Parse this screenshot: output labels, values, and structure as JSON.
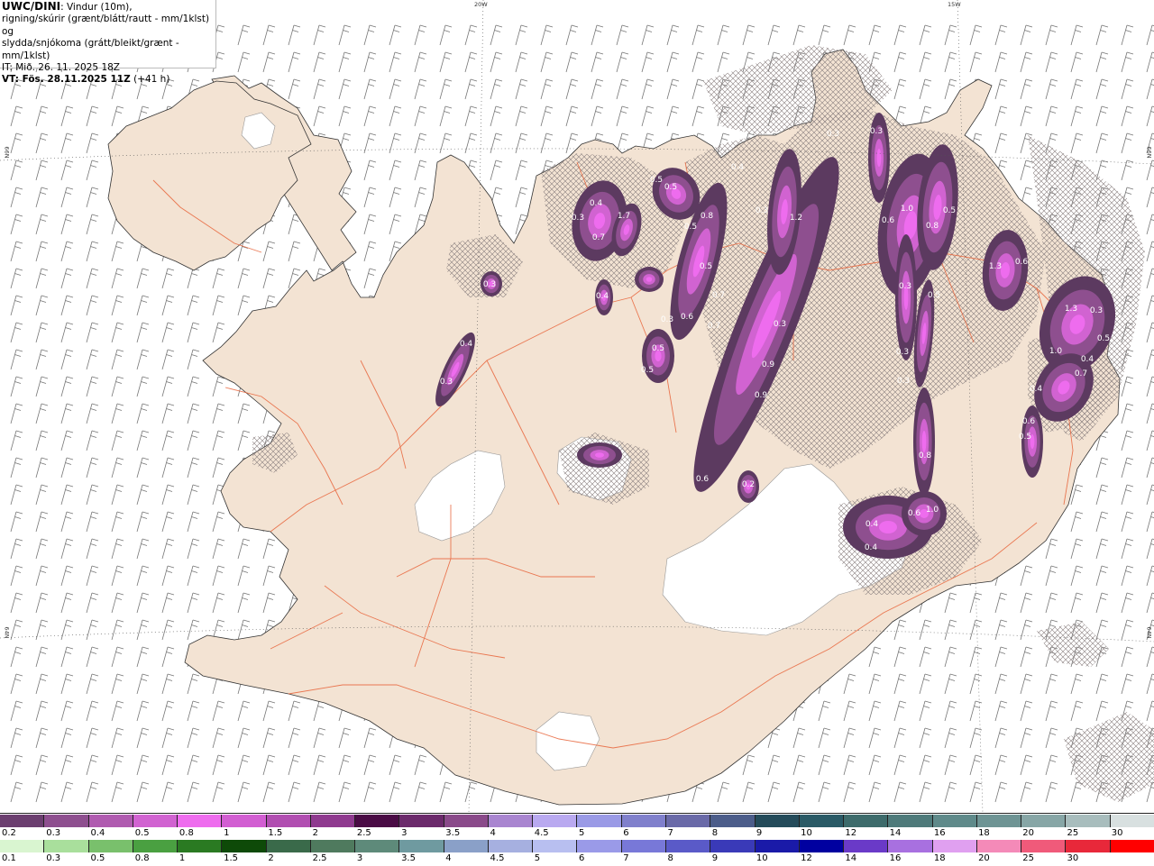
{
  "header": {
    "product": "UWC/DINI",
    "desc1": ": Vindur (10m),",
    "desc2": "rigning/skúrir (grænt/blátt/rautt - mm/1klst) og",
    "desc3": "slydda/snjókoma (grátt/bleikt/grænt - mm/1klst)",
    "it_line": "IT: Mið. 26. 11. 2025 18Z",
    "vt_bold": "VT: Fös. 28.11.2025 11Z",
    "vt_extra": " (+41 h)"
  },
  "graticule": {
    "top_20w": "20W",
    "top_15w": "15W",
    "left_66n": "66N",
    "left_64n": "64N",
    "right_66n": "66N",
    "right_64n": "64N"
  },
  "map_values": [
    {
      "v": "0.3"
    },
    {
      "v": "0.4"
    },
    {
      "v": "0.5"
    },
    {
      "v": "0.5"
    },
    {
      "v": "0.4"
    },
    {
      "v": "0.3"
    },
    {
      "v": "0.7"
    },
    {
      "v": "1.7"
    },
    {
      "v": "0.8"
    },
    {
      "v": "0.5"
    },
    {
      "v": "0.3"
    },
    {
      "v": "1.2"
    },
    {
      "v": "0.3"
    },
    {
      "v": "0.6"
    },
    {
      "v": "1.0"
    },
    {
      "v": "0.8"
    },
    {
      "v": "0.5"
    },
    {
      "v": "0.3"
    },
    {
      "v": "0.5"
    },
    {
      "v": "0.7"
    },
    {
      "v": "0.3"
    },
    {
      "v": "0.6"
    },
    {
      "v": "0.7"
    },
    {
      "v": "0.4"
    },
    {
      "v": "0.5"
    },
    {
      "v": "0.5"
    },
    {
      "v": "0.3"
    },
    {
      "v": "0.9"
    },
    {
      "v": "0.9"
    },
    {
      "v": "0.3"
    },
    {
      "v": "0.5"
    },
    {
      "v": "0.3"
    },
    {
      "v": "0.3"
    },
    {
      "v": "0.6"
    },
    {
      "v": "0.2"
    },
    {
      "v": "0.8"
    },
    {
      "v": "0.4"
    },
    {
      "v": "0.6"
    },
    {
      "v": "1.0"
    },
    {
      "v": "0.4"
    },
    {
      "v": "1.3"
    },
    {
      "v": "0.6"
    },
    {
      "v": "1.3"
    },
    {
      "v": "1.0"
    },
    {
      "v": "0.4"
    },
    {
      "v": "0.5"
    },
    {
      "v": "0.7"
    },
    {
      "v": "0.4"
    },
    {
      "v": "0.6"
    },
    {
      "v": "0.5"
    },
    {
      "v": "0.3"
    },
    {
      "v": "0.3"
    },
    {
      "v": "0.4"
    }
  ],
  "legend": {
    "snow_labels": [
      "0.2",
      "0.3",
      "0.4",
      "0.5",
      "0.8",
      "1",
      "1.5",
      "2",
      "2.5",
      "3",
      "3.5",
      "4",
      "4.5",
      "5",
      "6",
      "7",
      "8",
      "9",
      "10",
      "12",
      "14",
      "16",
      "18",
      "20",
      "25",
      "30"
    ],
    "snow_colors": [
      "#6b3e6f",
      "#8e4f8f",
      "#b05bb0",
      "#d163d1",
      "#ee6cee",
      "#d25ed2",
      "#b14eb1",
      "#8f3a8f",
      "#4a0b45",
      "#6b2a6b",
      "#8a4a8a",
      "#a985d0",
      "#b9a9f0",
      "#9a9ae6",
      "#8080cc",
      "#6a6aa8",
      "#4c5d8a",
      "#244b5a",
      "#2a5a66",
      "#3d6b6b",
      "#4e7a7a",
      "#5f8a8a",
      "#6e9494",
      "#87a6a6",
      "#a8bdbd",
      "#d8e0e0"
    ],
    "rain_labels": [
      "0.1",
      "0.3",
      "0.5",
      "0.8",
      "1",
      "1.5",
      "2",
      "2.5",
      "3",
      "3.5",
      "4",
      "4.5",
      "5",
      "6",
      "7",
      "8",
      "9",
      "10",
      "12",
      "14",
      "16",
      "18",
      "20",
      "25",
      "30"
    ],
    "rain_colors": [
      "#d9f5d0",
      "#a9df9c",
      "#79c06c",
      "#4aa041",
      "#2a7a22",
      "#0e4a08",
      "#3a6a4a",
      "#4f7a5e",
      "#5e8a7a",
      "#6f9aa0",
      "#8aa0c8",
      "#a6b0e0",
      "#b8bff0",
      "#9a9ae8",
      "#7878d8",
      "#5a5ac8",
      "#3a3ab8",
      "#1a1aa8",
      "#0000a0",
      "#6a3ac8",
      "#a870e0",
      "#e0a0f0",
      "#f48ab8",
      "#f05a7a",
      "#e8283a",
      "#ff0000"
    ]
  }
}
